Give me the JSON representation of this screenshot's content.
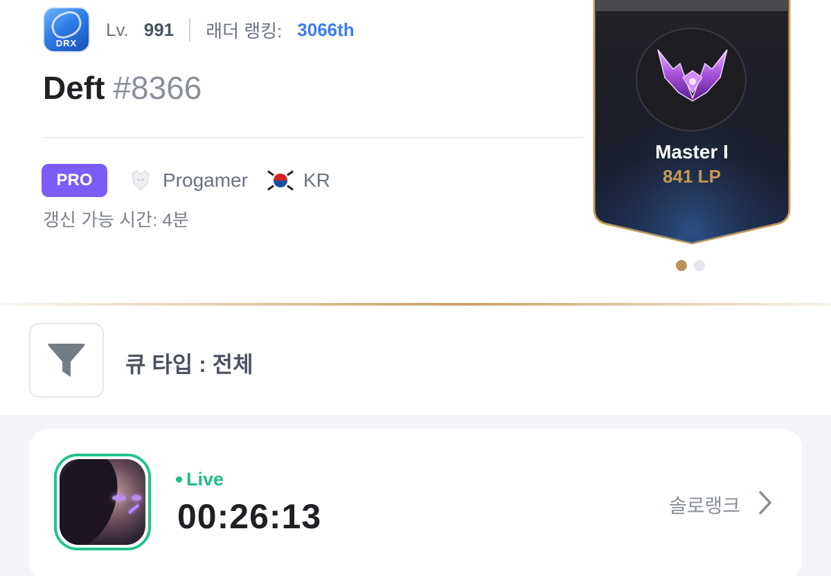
{
  "profile": {
    "team_logo_text": "DRX",
    "level_label": "Lv.",
    "level_value": "991",
    "ladder_label": "래더 랭킹:",
    "ladder_value": "3066th",
    "name": "Deft",
    "tag": "#8366",
    "pro_badge": "PRO",
    "role": "Progamer",
    "region": "KR",
    "refresh_text": "갱신 가능 시간: 4분"
  },
  "rank": {
    "tier": "Master I",
    "lp": "841 LP",
    "page_count": 2,
    "active_page": 1
  },
  "filter": {
    "queue_label": "큐 타입 : 전체"
  },
  "live_match": {
    "status": "Live",
    "elapsed": "00:26:13",
    "queue": "솔로랭크"
  },
  "colors": {
    "pro_badge": "#7b5cf5",
    "ladder_rank": "#3b7cf0",
    "live": "#1cbf86",
    "lp_gold": "#c49a55",
    "card_border_gold": "#c9a25e"
  },
  "icons": [
    "team-logo-icon",
    "progamer-icon",
    "korea-flag-icon",
    "master-emblem-icon",
    "filter-icon",
    "champion-portrait",
    "chevron-right-icon"
  ]
}
